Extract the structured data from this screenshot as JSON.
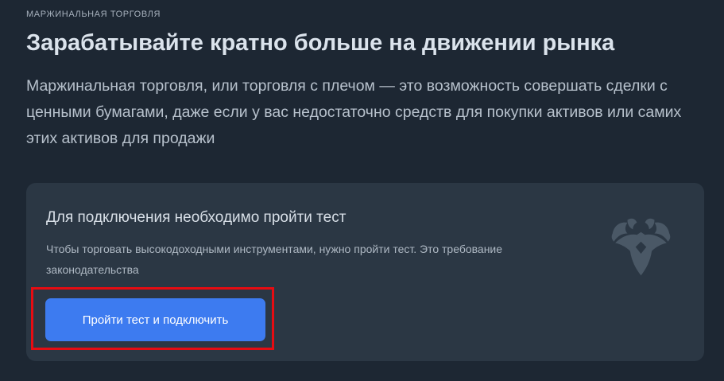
{
  "header": {
    "eyebrow": "МАРЖИНАЛЬНАЯ ТОРГОВЛЯ",
    "title": "Зарабатывайте кратно больше на движении рынка",
    "description": "Маржинальная торговля, или торговля с плечом — это возможность совершать сделки с ценными бумагами, даже если у вас недостаточно средств для покупки активов или самих этих активов для продажи"
  },
  "card": {
    "title": "Для подключения необходимо пройти тест",
    "text": "Чтобы торговать высокодоходными инструментами, нужно пройти тест. Это требование законодательства",
    "button_label": "Пройти тест и подключить",
    "emblem_icon": "double-headed-eagle-icon"
  },
  "colors": {
    "background": "#1d2733",
    "card_background": "#2b3744",
    "accent": "#3d7bf0",
    "highlight": "#e60c12"
  }
}
